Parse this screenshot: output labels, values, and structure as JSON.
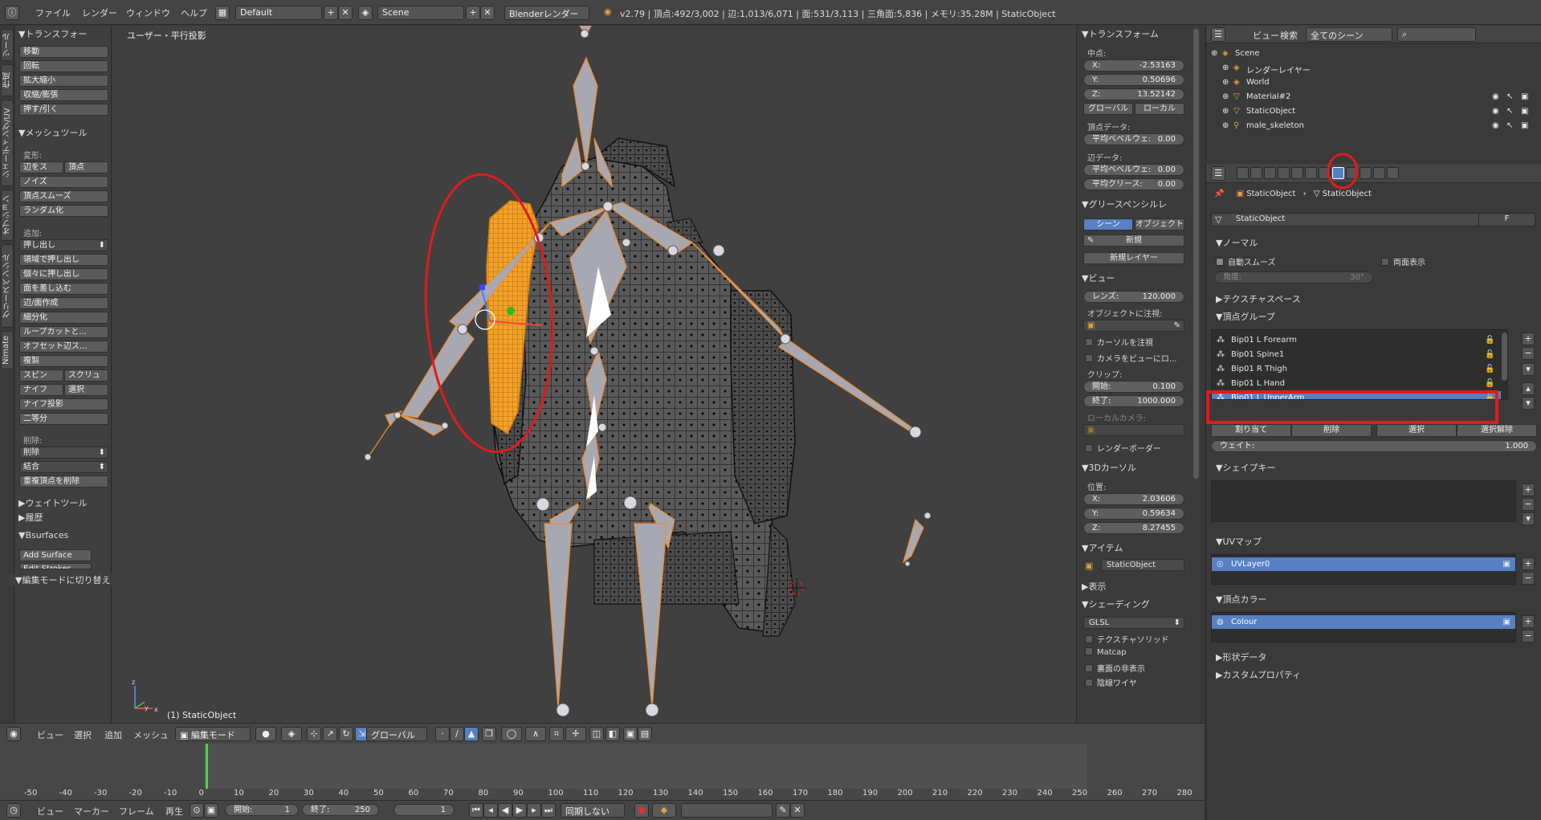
{
  "topbar": {
    "menus": [
      "ファイル",
      "レンダー",
      "ウィンドウ",
      "ヘルプ"
    ],
    "layout": "Default",
    "scene": "Scene",
    "engine": "Blenderレンダー",
    "stats": "v2.79 | 頂点:492/3,002 | 辺:1,013/6,071 | 面:531/3,113 | 三角面:5,836 | メモリ:35.28M | StaticObject"
  },
  "left_tabs": [
    "ツール",
    "作成",
    "シェーディング/UV",
    "オプション",
    "グリースペンシル",
    "Nimate"
  ],
  "toolshelf": {
    "transform_header": "▼トランスフォー",
    "transform_buttons": [
      "移動",
      "回転",
      "拡大縮小",
      "収縮/膨張",
      "押す/引く"
    ],
    "mesh_tools_header": "▼メッシュツール",
    "deform_label": "変形:",
    "deform_pair": [
      "辺をス",
      "頂点"
    ],
    "deform_buttons": [
      "ノイズ",
      "頂点スムーズ",
      "ランダム化"
    ],
    "add_label": "追加:",
    "extrude_dropdown": "押し出し",
    "add_buttons": [
      "領域で押し出し",
      "個々に押し出し",
      "面を差し込む",
      "辺/面作成",
      "細分化",
      "ループカットと...",
      "オフセット辺ス...",
      "複製"
    ],
    "spin_pair": [
      "スピン",
      "スクリュ"
    ],
    "knife_pair": [
      "ナイフ",
      "選択"
    ],
    "knife_project": "ナイフ投影",
    "bisect": "二等分",
    "delete_label": "削除:",
    "delete_dropdown": "削除",
    "merge_dropdown": "結合",
    "remove_doubles": "重複頂点を削除",
    "weight_tools": "▶ウェイトツール",
    "history": "▶履歴",
    "bsurfaces": "▼Bsurfaces",
    "add_surface": "Add Surface",
    "edit_strokes": "Edit Strokes",
    "operator": "▼編集モードに切り替え"
  },
  "viewport": {
    "title": "ユーザー・平行投影",
    "object_label": "(1) StaticObject"
  },
  "npanel": {
    "transform_header": "▼トランスフォーム",
    "median_label": "中点:",
    "median": [
      {
        "k": "X:",
        "v": "-2.53163"
      },
      {
        "k": "Y:",
        "v": "0.50696"
      },
      {
        "k": "Z:",
        "v": "13.52142"
      }
    ],
    "global": "グローバル",
    "local": "ローカル",
    "vertex_data": "頂点データ:",
    "vertex_bevel": {
      "k": "平均ベベルウェ:",
      "v": "0.00"
    },
    "edge_data": "辺データ:",
    "edge_bevel": {
      "k": "平均ベベルウェ:",
      "v": "0.00"
    },
    "edge_crease": {
      "k": "平均クリース:",
      "v": "0.00"
    },
    "grease_header": "▼グリースペンシルレ",
    "gp_scene": "シーン",
    "gp_object": "オブジェクト",
    "gp_new": "新規",
    "gp_new_layer": "新規レイヤー",
    "view_header": "▼ビュー",
    "lens": {
      "k": "レンズ:",
      "v": "120.000"
    },
    "lock_to_object": "オブジェクトに注視:",
    "lock_cursor": "カーソルを注視",
    "lock_camera": "カメラをビューにロ...",
    "clip_label": "クリップ:",
    "clip_start": {
      "k": "開始:",
      "v": "0.100"
    },
    "clip_end": {
      "k": "終了:",
      "v": "1000.000"
    },
    "local_camera": "ローカルカメラ:",
    "render_border": "レンダーボーダー",
    "cursor_header": "▼3Dカーソル",
    "location_label": "位置:",
    "cursor": [
      {
        "k": "X:",
        "v": "2.03606"
      },
      {
        "k": "Y:",
        "v": "0.59634"
      },
      {
        "k": "Z:",
        "v": "8.27455"
      }
    ],
    "item_header": "▼アイテム",
    "item_name": "StaticObject",
    "display_header": "▶表示",
    "shading_header": "▼シェーディング",
    "shading_mode": "GLSL",
    "textured_solid": "テクスチャソリッド",
    "matcap": "Matcap",
    "backface": "裏面の非表示",
    "hidden_wire": "陰線ワイヤ"
  },
  "outliner": {
    "menus": [
      "ビュー",
      "検索"
    ],
    "filter": "全てのシーン",
    "rows": [
      {
        "label": "Scene",
        "indent": 0,
        "icon": "scene-icon"
      },
      {
        "label": "レンダーレイヤー",
        "indent": 1,
        "icon": "render-layer-icon"
      },
      {
        "label": "World",
        "indent": 1,
        "icon": "world-icon"
      },
      {
        "label": "Material#2",
        "indent": 1,
        "icon": "mesh-icon"
      },
      {
        "label": "StaticObject",
        "indent": 1,
        "icon": "mesh-icon"
      },
      {
        "label": "male_skeleton",
        "indent": 1,
        "icon": "armature-icon"
      }
    ]
  },
  "properties": {
    "breadcrumb": [
      "StaticObject",
      "StaticObject"
    ],
    "datablock": "StaticObject",
    "fake_user": "F",
    "normals_header": "▼ノーマル",
    "auto_smooth": "自動スムーズ",
    "double_sided": "両面表示",
    "angle": {
      "k": "角度:",
      "v": "30°"
    },
    "texture_space": "▶テクスチャスペース",
    "vgroups_header": "▼頂点グループ",
    "vertex_groups": [
      "Bip01 L Forearm",
      "Bip01 Spine1",
      "Bip01 R Thigh",
      "Bip01 L Hand",
      "Bip01 L UpperArm"
    ],
    "vg_selected": 4,
    "vg_buttons": [
      "割り当て",
      "削除",
      "選択",
      "選択解除"
    ],
    "weight": {
      "k": "ウェイト:",
      "v": "1.000"
    },
    "shape_keys": "▼シェイプキー",
    "uv_maps": "▼UVマップ",
    "uv_layer": "UVLayer0",
    "vcolors": "▼頂点カラー",
    "vcolor": "Colour",
    "geometry_data": "▶形状データ",
    "custom_props": "▶カスタムプロパティ"
  },
  "view3d_header": {
    "menus": [
      "ビュー",
      "選択",
      "追加",
      "メッシュ"
    ],
    "mode": "編集モード",
    "orientation": "グローバル"
  },
  "timeline": {
    "ticks": [
      "-50",
      "-40",
      "-30",
      "-20",
      "-10",
      "0",
      "10",
      "20",
      "30",
      "40",
      "50",
      "60",
      "70",
      "80",
      "90",
      "100",
      "110",
      "120",
      "130",
      "140",
      "150",
      "160",
      "170",
      "180",
      "190",
      "200",
      "210",
      "220",
      "230",
      "240",
      "250",
      "260",
      "270",
      "280"
    ],
    "menus": [
      "ビュー",
      "マーカー",
      "フレーム",
      "再生"
    ],
    "start": {
      "k": "開始:",
      "v": "1"
    },
    "end": {
      "k": "終了:",
      "v": "250"
    },
    "current": "1",
    "sync": "同期しない"
  },
  "colors": {
    "selection_blue": "#5680c2",
    "highlight_red": "#e01b1b",
    "mesh_orange": "#f0a020"
  }
}
